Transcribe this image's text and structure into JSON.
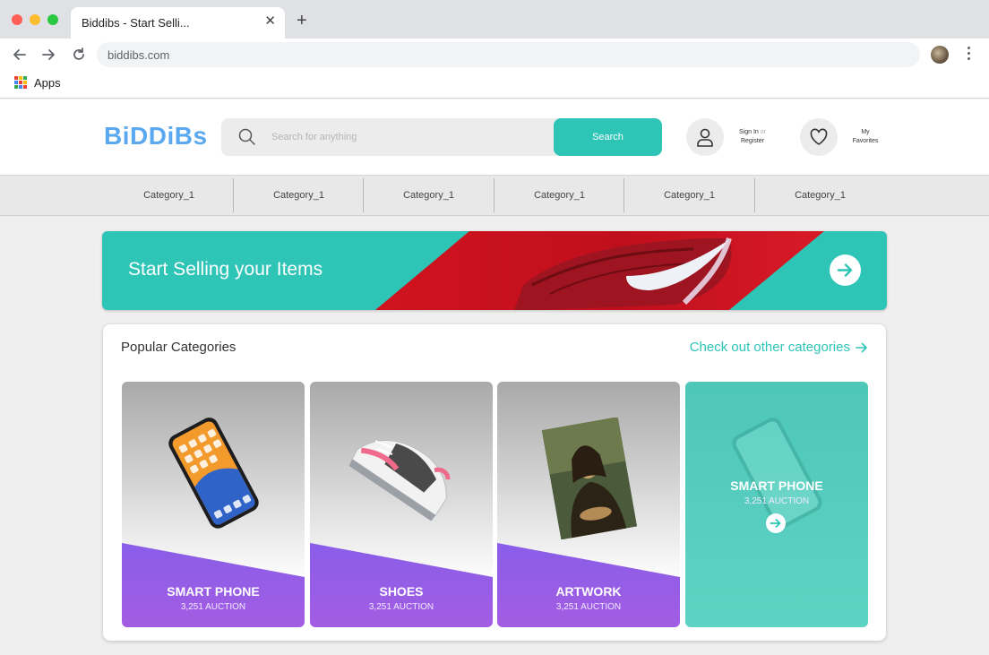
{
  "browser": {
    "tab_title": "Biddibs - Start Selli...",
    "tab_close": "✕",
    "new_tab": "+",
    "url": "biddibs.com",
    "bookmarks_label": "Apps"
  },
  "header": {
    "logo": "BiDDiBs",
    "search_placeholder": "Search for anything",
    "search_button": "Search",
    "sign_in": "Sign In",
    "or": "or",
    "register": "Register",
    "my": "My",
    "favorites": "Favorites"
  },
  "category_nav": [
    "Category_1",
    "Category_1",
    "Category_1",
    "Category_1",
    "Category_1",
    "Category_1"
  ],
  "banner": {
    "title": "Start Selling your Items"
  },
  "popular": {
    "title": "Popular Categories",
    "link": "Check out other categories",
    "cards": [
      {
        "name": "SMART PHONE",
        "count": "3,251 AUCTION"
      },
      {
        "name": "SHOES",
        "count": "3,251 AUCTION"
      },
      {
        "name": "ARTWORK",
        "count": "3,251 AUCTION"
      },
      {
        "name": "SMART PHONE",
        "count": "3,251 AUCTION"
      }
    ]
  },
  "colors": {
    "accent": "#2ec4b6",
    "logo": "#5aa8f0",
    "purple": "#9b5de5",
    "banner_red": "#d0131f"
  },
  "icons": [
    "back-arrow-icon",
    "forward-arrow-icon",
    "reload-icon",
    "apps-grid-icon",
    "search-icon",
    "user-icon",
    "heart-icon",
    "arrow-right-icon"
  ]
}
